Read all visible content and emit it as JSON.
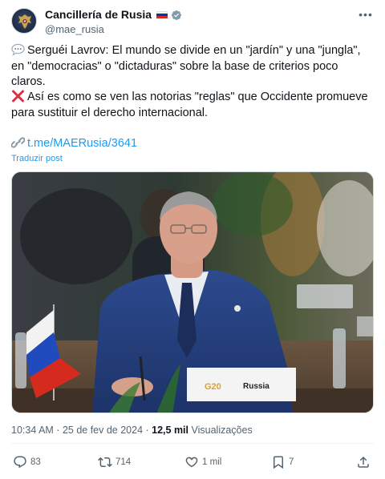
{
  "author": {
    "display_name": "Cancillería de Rusia",
    "handle": "@mae_rusia",
    "flag_icon": "russia-flag-icon",
    "verified_icon": "verified-badge-icon",
    "verified_color": "#829aab"
  },
  "tweet": {
    "paragraph1": "Serguéi Lavrov: El mundo se divide en un \"jardín\" y una \"jungla\", en \"democracias\" o \"dictaduras\" sobre la base de criterios poco claros.",
    "paragraph2": "Así es como se ven las notorias \"reglas\" que Occidente promueve para sustituir el derecho internacional.",
    "link": "t.me/MAERusia/3641",
    "translate": "Traduzir post",
    "emoji1": "speech-balloon-icon",
    "emoji2": "cross-mark-icon",
    "emoji3": "link-icon"
  },
  "media": {
    "placard": "Russia",
    "logo": "G20"
  },
  "meta": {
    "time": "10:34 AM",
    "separator": " · ",
    "date": "25 de fev de 2024",
    "views_count": "12,5 mil",
    "views_label": "Visualizações"
  },
  "actions": {
    "replies": "83",
    "reposts": "714",
    "likes": "1 mil",
    "bookmarks": "7"
  },
  "colors": {
    "link": "#1d9bf0",
    "secondary_text": "#536471",
    "primary_text": "#0f1419"
  }
}
